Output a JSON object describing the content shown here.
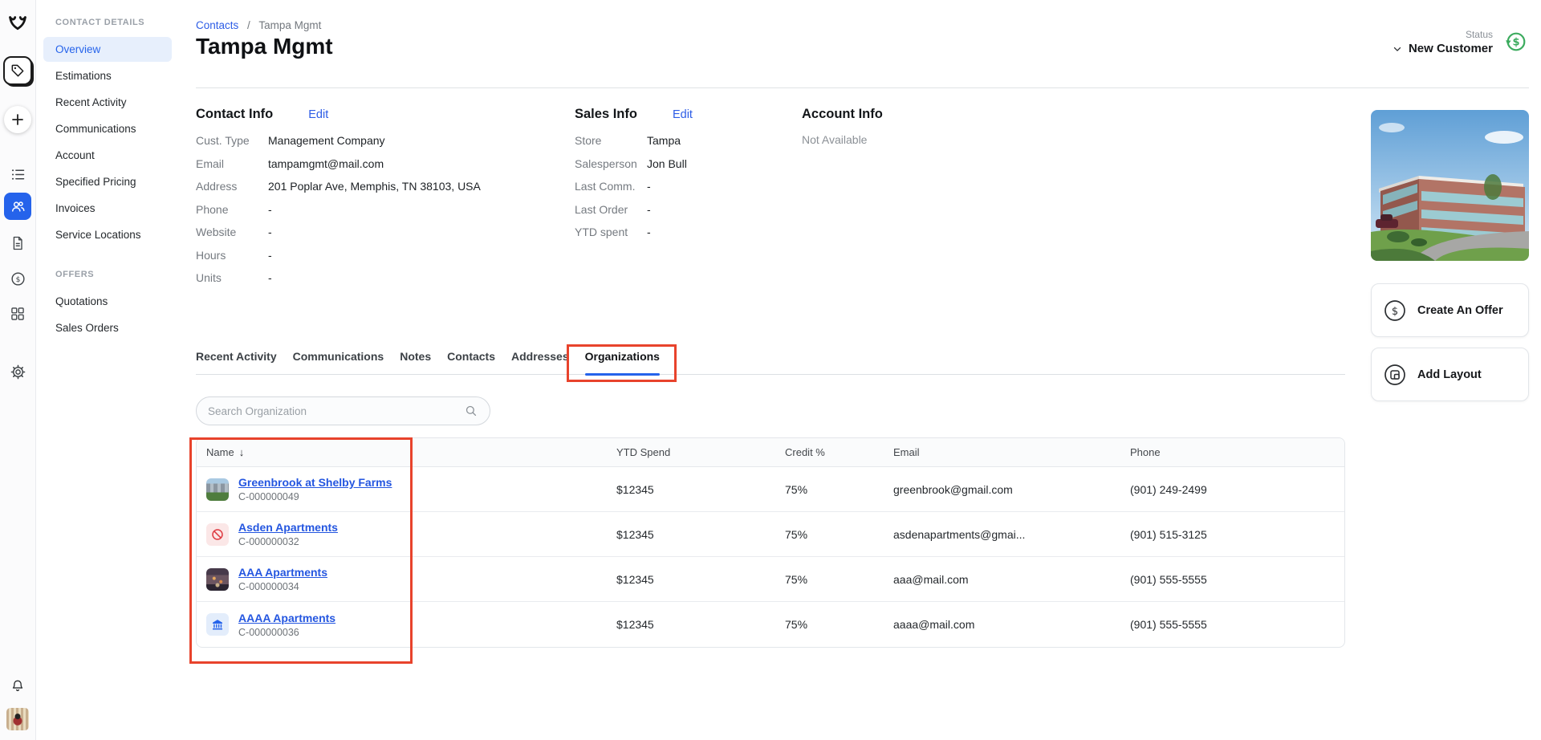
{
  "colors": {
    "accent_blue": "#2563eb",
    "link_blue": "#2c5ce6",
    "active_item_bg": "#e7effc",
    "annotation_red": "#e8432c",
    "status_green": "#3cab5e",
    "border_gray": "#e3e6ea"
  },
  "rail": {
    "icons": [
      "logo",
      "tag",
      "add",
      "list",
      "contacts",
      "document",
      "billing",
      "apps",
      "settings",
      "notifications",
      "avatar"
    ],
    "active_icon": "contacts"
  },
  "sidebar": {
    "sections": [
      {
        "title": "CONTACT DETAILS",
        "items": [
          {
            "label": "Overview",
            "active": true
          },
          {
            "label": "Estimations",
            "active": false
          },
          {
            "label": "Recent Activity",
            "active": false
          },
          {
            "label": "Communications",
            "active": false
          },
          {
            "label": "Account",
            "active": false
          },
          {
            "label": "Specified Pricing",
            "active": false
          },
          {
            "label": "Invoices",
            "active": false
          },
          {
            "label": "Service Locations",
            "active": false
          }
        ]
      },
      {
        "title": "OFFERS",
        "items": [
          {
            "label": "Quotations",
            "active": false
          },
          {
            "label": "Sales Orders",
            "active": false
          }
        ]
      }
    ]
  },
  "header": {
    "breadcrumb": {
      "root": "Contacts",
      "separator": "/",
      "current": "Tampa Mgmt"
    },
    "title": "Tampa Mgmt",
    "status_label": "Status",
    "status_value": "New Customer"
  },
  "info": {
    "contact": {
      "title": "Contact Info",
      "edit_label": "Edit",
      "rows": [
        {
          "label": "Cust. Type",
          "value": "Management Company"
        },
        {
          "label": "Email",
          "value": "tampamgmt@mail.com"
        },
        {
          "label": "Address",
          "value": "201 Poplar Ave, Memphis, TN 38103, USA"
        },
        {
          "label": "Phone",
          "value": "-"
        },
        {
          "label": "Website",
          "value": "-"
        },
        {
          "label": "Hours",
          "value": "-"
        },
        {
          "label": "Units",
          "value": "-"
        }
      ]
    },
    "sales": {
      "title": "Sales Info",
      "edit_label": "Edit",
      "rows": [
        {
          "label": "Store",
          "value": "Tampa"
        },
        {
          "label": "Salesperson",
          "value": "Jon Bull"
        },
        {
          "label": "Last Comm.",
          "value": "-"
        },
        {
          "label": "Last Order",
          "value": "-"
        },
        {
          "label": "YTD spent",
          "value": "-"
        }
      ]
    },
    "account": {
      "title": "Account Info",
      "empty": "Not Available"
    }
  },
  "right_panel": {
    "create_offer_label": "Create An Offer",
    "add_layout_label": "Add Layout"
  },
  "tabs": {
    "items": [
      {
        "label": "Recent Activity"
      },
      {
        "label": "Communications"
      },
      {
        "label": "Notes"
      },
      {
        "label": "Contacts"
      },
      {
        "label": "Addresses"
      },
      {
        "label": "Organizations"
      }
    ],
    "active": "Organizations"
  },
  "search": {
    "placeholder": "Search Organization"
  },
  "table": {
    "headers": {
      "name": "Name",
      "ytd": "YTD Spend",
      "credit": "Credit %",
      "email": "Email",
      "phone": "Phone"
    },
    "sort_arrow": "↓",
    "rows": [
      {
        "icon": "city-photo",
        "name": "Greenbrook at Shelby Farms",
        "id": "C-000000049",
        "ytd": "$12345",
        "credit": "75%",
        "email": "greenbrook@gmail.com",
        "phone": "(901) 249-2499"
      },
      {
        "icon": "prohibited",
        "name": "Asden Apartments",
        "id": "C-000000032",
        "ytd": "$12345",
        "credit": "75%",
        "email": "asdenapartments@gmai...",
        "phone": "(901) 515-3125"
      },
      {
        "icon": "night-photo",
        "name": "AAA Apartments",
        "id": "C-000000034",
        "ytd": "$12345",
        "credit": "75%",
        "email": "aaa@mail.com",
        "phone": "(901) 555-5555"
      },
      {
        "icon": "bank",
        "name": "AAAA Apartments",
        "id": "C-000000036",
        "ytd": "$12345",
        "credit": "75%",
        "email": "aaaa@mail.com",
        "phone": "(901) 555-5555"
      }
    ]
  }
}
